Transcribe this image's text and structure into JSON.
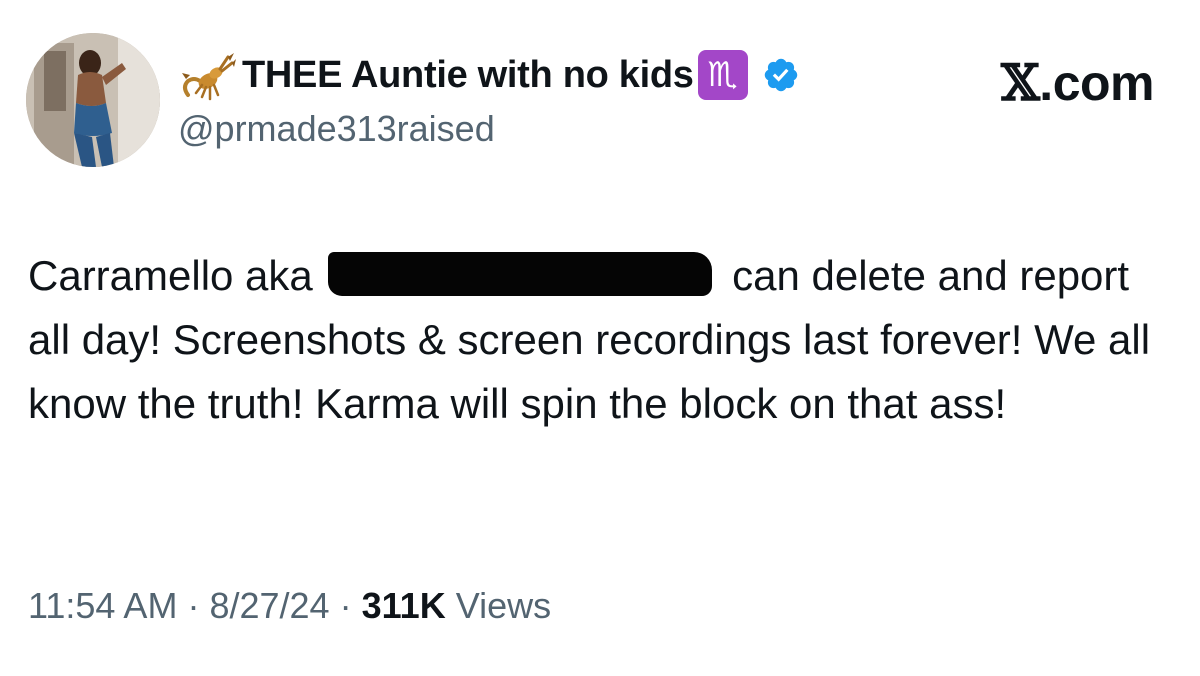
{
  "tweet": {
    "author": {
      "display_name": "THEE Auntie with no kids",
      "name_prefix_icon": "scorpion-icon",
      "name_suffix_icon": "scorpio-zodiac-icon",
      "zodiac_glyph": "♏",
      "verified": true,
      "verified_color": "#1d9bf0",
      "handle": "@prmade313raised"
    },
    "site_label": {
      "mark": "𝕏",
      "text": ".com"
    },
    "body": {
      "before_redaction": "Carramello aka",
      "after_redaction": "can delete and report all day! Screenshots & screen recordings last forever! We all know the truth! Karma will spin the block on that ass!"
    },
    "meta": {
      "time": "11:54 AM",
      "separator": "·",
      "date": "8/27/24",
      "views_count": "311K",
      "views_label": "Views"
    }
  },
  "colors": {
    "text_primary": "#0f1419",
    "text_secondary": "#536471",
    "zodiac_badge": "#a347c8",
    "redaction": "#050505"
  }
}
